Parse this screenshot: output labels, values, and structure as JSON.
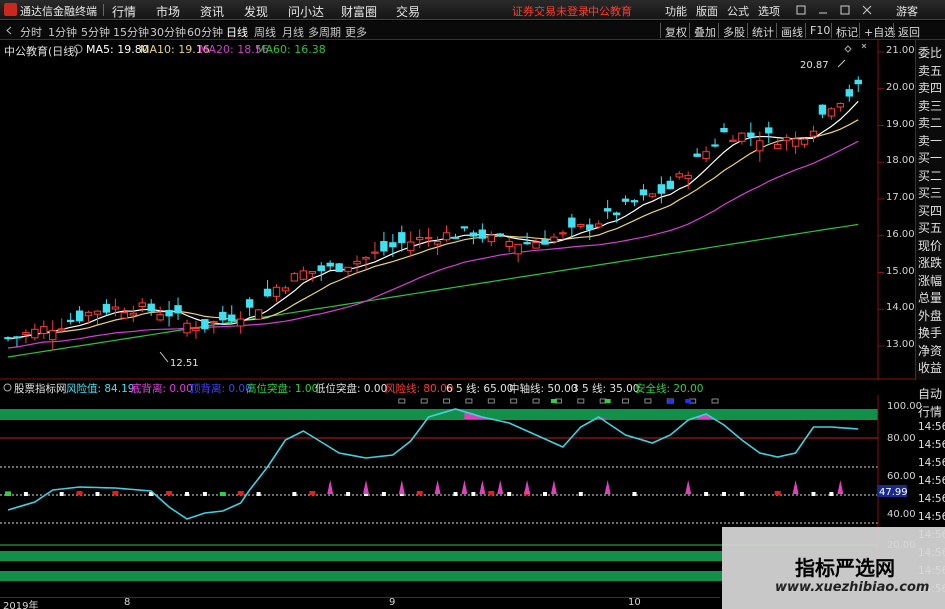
{
  "menubar": {
    "app_title": "通达信金融终端",
    "items": [
      "行情",
      "市场",
      "资讯",
      "发现",
      "问小达",
      "财富圈",
      "交易"
    ],
    "warning": "证券交易未登录",
    "company": "中公教育",
    "right_items": [
      "功能",
      "版面",
      "公式",
      "选项"
    ],
    "guest": "游客"
  },
  "toolbar": {
    "periods": [
      "分时",
      "1分钟",
      "5分钟",
      "15分钟",
      "30分钟",
      "60分钟",
      "日线",
      "周线",
      "月线",
      "多周期",
      "更多"
    ],
    "active_period": "日线",
    "buttons": [
      "复权",
      "叠加",
      "多股",
      "统计",
      "画线",
      "F10",
      "标记",
      "+自选",
      "返回"
    ]
  },
  "chart": {
    "title": "中公教育(日线)",
    "ma5": "MA5: 19.80",
    "ma10": "MA10: 19.16",
    "ma20": "MA20: 18.56",
    "ma60": "MA60: 16.38",
    "high_annotation": "20.87",
    "low_annotation": "12.51",
    "price_ticks": [
      "21.00",
      "20.00",
      "19.00",
      "18.00",
      "17.00",
      "16.00",
      "15.00",
      "14.00",
      "13.00"
    ],
    "colors": {
      "ma5": "#ffffff",
      "ma10": "#e8d37a",
      "ma20": "#d040d0",
      "ma60": "#30c040",
      "up": "#ff3a3a",
      "down": "#40e0f0"
    }
  },
  "right_panel": {
    "items": [
      "委比",
      "卖五",
      "卖四",
      "卖三",
      "卖二",
      "卖一",
      "买一",
      "买二",
      "买三",
      "买四",
      "买五",
      "现价",
      "涨跌",
      "涨幅",
      "总量",
      "外盘",
      "换手",
      "净资",
      "收益"
    ],
    "lower_items": [
      "自动",
      "行情",
      "14:56",
      "14:56",
      "14:56",
      "14:56",
      "14:56",
      "14:56",
      "14:56",
      "14:56",
      "14:56",
      "14:56"
    ]
  },
  "indicator": {
    "name": "股票指标网",
    "risk": "风险值: 84.19",
    "bottom_back": "底背离: 0.00",
    "top_back": "顶背离: 0.00",
    "high_break": "高位突盘: 1.00",
    "low_break": "低位突盘: 0.00",
    "risk_line": "风险线: 80.00",
    "line65": "6 5 线: 65.00",
    "mid_line": "中轴线: 50.00",
    "line35": "3 5 线: 35.00",
    "safe_line": "安全线: 20.00",
    "axis_ticks": [
      "100.00",
      "80.00",
      "60.00",
      "47.99",
      "40.00",
      "20.00"
    ],
    "current_value": "47.99"
  },
  "dates": [
    "2019年",
    "8",
    "9",
    "10"
  ],
  "watermark": {
    "title": "指标严选网",
    "url": "www.xuezhibiao.com"
  }
}
